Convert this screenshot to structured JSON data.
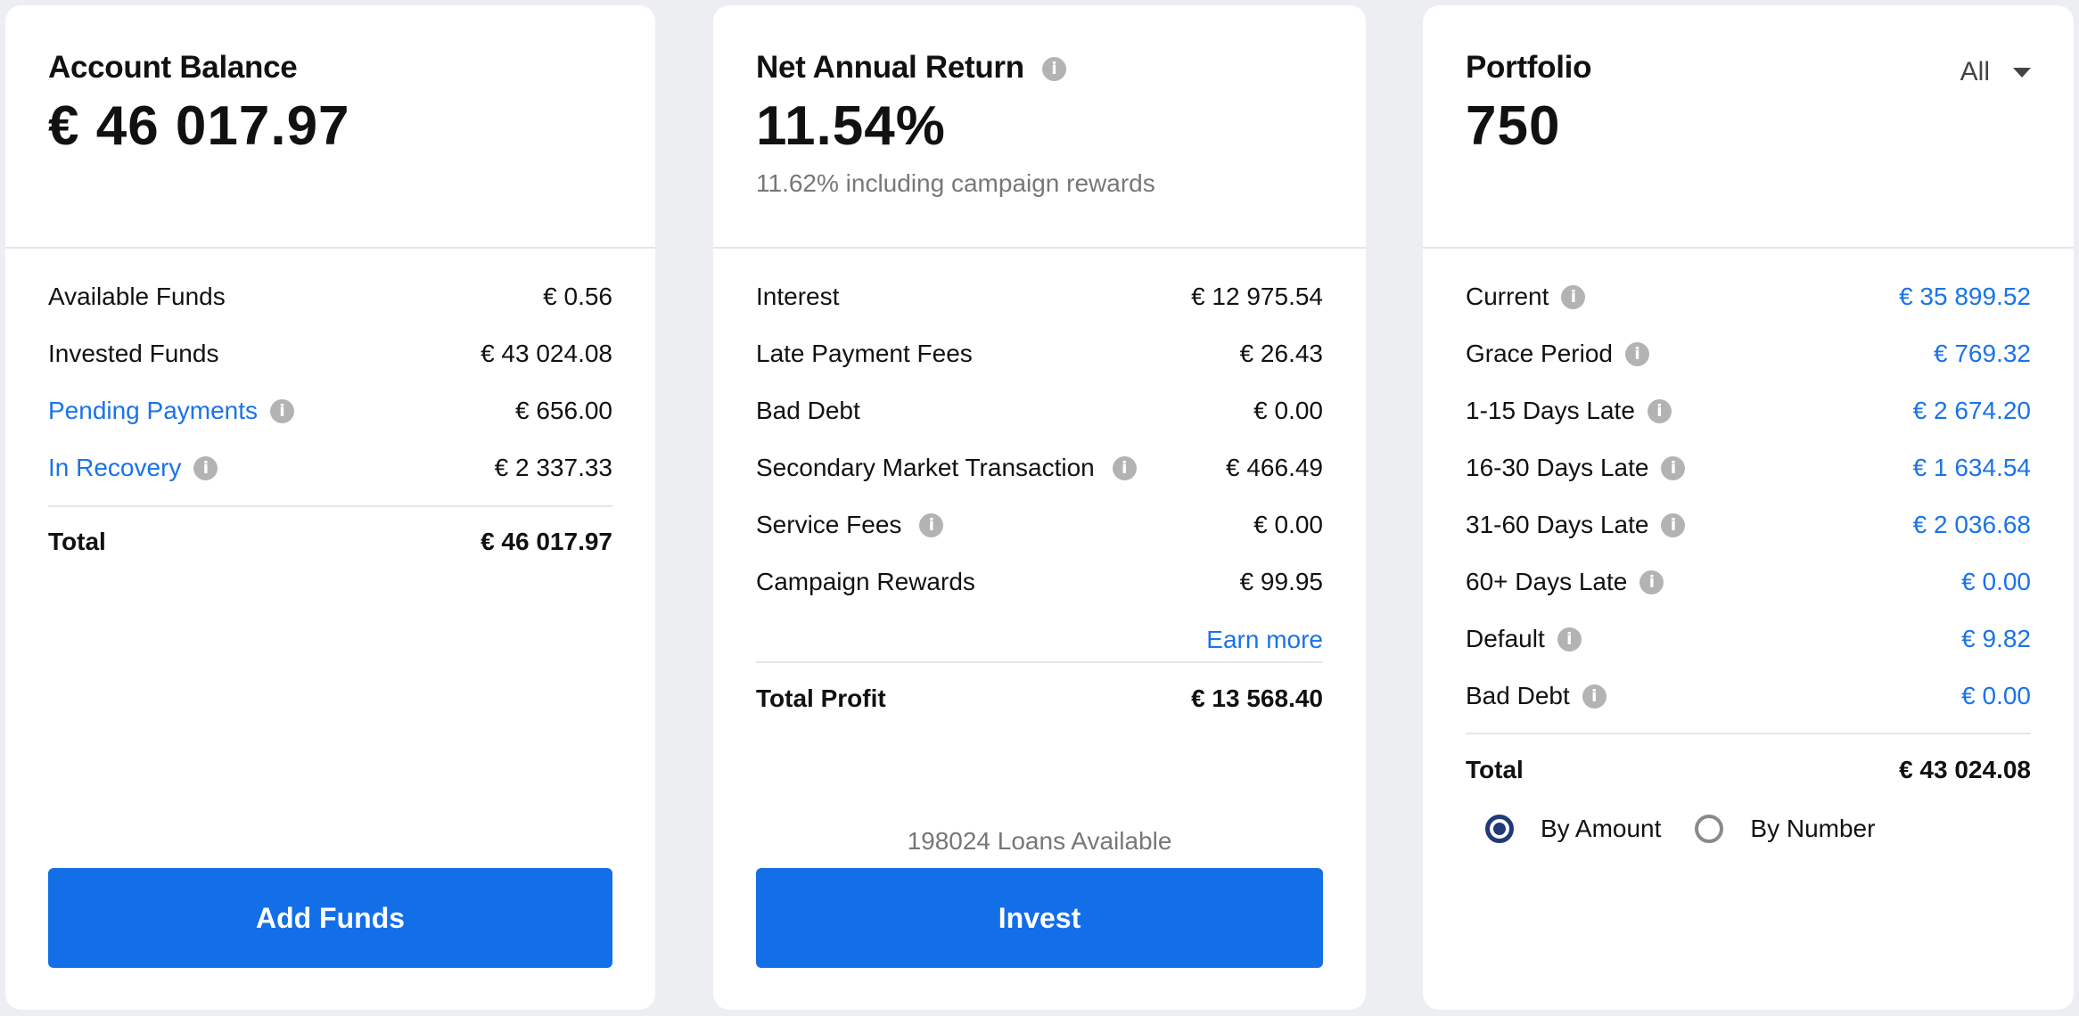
{
  "account_balance": {
    "title": "Account Balance",
    "amount": "€ 46 017.97",
    "rows": [
      {
        "label": "Available Funds",
        "value": "€ 0.56"
      },
      {
        "label": "Invested Funds",
        "value": "€ 43 024.08"
      },
      {
        "label": "Pending Payments",
        "value": "€ 656.00"
      },
      {
        "label": "In Recovery",
        "value": "€ 2 337.33"
      }
    ],
    "total_label": "Total",
    "total_value": "€ 46 017.97",
    "button": "Add Funds"
  },
  "net_annual_return": {
    "title": "Net Annual Return",
    "amount": "11.54%",
    "subtitle": "11.62% including campaign rewards",
    "rows": [
      {
        "label": "Interest",
        "value": "€ 12 975.54"
      },
      {
        "label": "Late Payment Fees",
        "value": "€ 26.43"
      },
      {
        "label": "Bad Debt",
        "value": "€ 0.00"
      },
      {
        "label": "Secondary Market Transaction",
        "value": "€ 466.49"
      },
      {
        "label": "Service Fees",
        "value": "€ 0.00"
      },
      {
        "label": "Campaign Rewards",
        "value": "€ 99.95"
      }
    ],
    "earn_more": "Earn more",
    "total_label": "Total Profit",
    "total_value": "€ 13 568.40",
    "loans_available": "198024 Loans Available",
    "button": "Invest"
  },
  "portfolio": {
    "title": "Portfolio",
    "count": "750",
    "filter": "All",
    "rows": [
      {
        "label": "Current",
        "value": "€ 35 899.52"
      },
      {
        "label": "Grace Period",
        "value": "€ 769.32"
      },
      {
        "label": "1-15 Days Late",
        "value": "€ 2 674.20"
      },
      {
        "label": "16-30 Days Late",
        "value": "€ 1 634.54"
      },
      {
        "label": "31-60 Days Late",
        "value": "€ 2 036.68"
      },
      {
        "label": "60+ Days Late",
        "value": "€ 0.00"
      },
      {
        "label": "Default",
        "value": "€ 9.82"
      },
      {
        "label": "Bad Debt",
        "value": "€ 0.00"
      }
    ],
    "total_label": "Total",
    "total_value": "€ 43 024.08",
    "radio_by_amount": "By Amount",
    "radio_by_number": "By Number",
    "selected_radio": "By Amount"
  },
  "info_glyph": "i",
  "colors": {
    "accent": "#136fe8",
    "link": "#1a73e8",
    "radio": "#203a7a",
    "background": "#eceef1"
  }
}
